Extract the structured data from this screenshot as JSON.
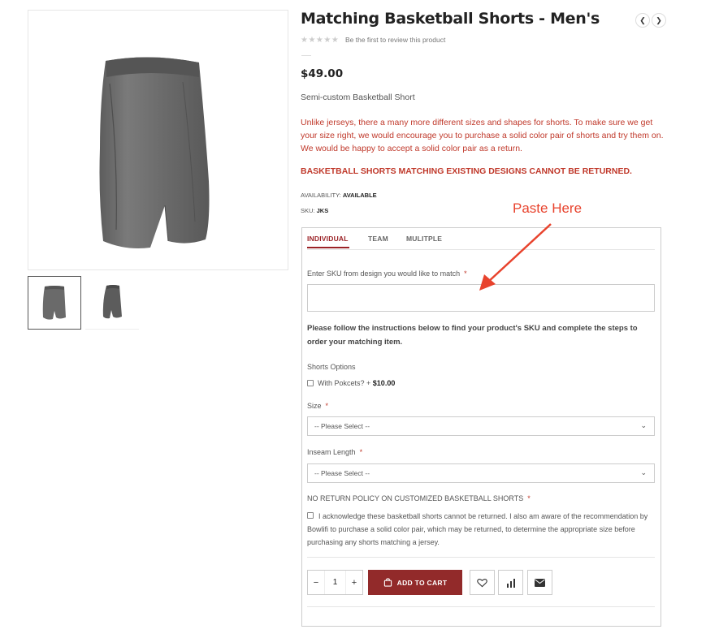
{
  "product": {
    "title": "Matching Basketball Shorts - Men's",
    "review_link": "Be the first to review this product",
    "price": "$49.00",
    "subtitle": "Semi-custom Basketball Short",
    "description": "Unlike jerseys, there a many more different sizes and shapes for shorts.  To make sure we get your size right, we would encourage you to purchase a solid color pair of shorts and try them on.  We would be happy to accept a solid color pair as a return.",
    "warning": "BASKETBALL SHORTS MATCHING EXISTING DESIGNS CANNOT BE RETURNED.",
    "availability_label": "AVAILABILITY:",
    "availability_value": "AVAILABLE",
    "sku_label": "SKU:",
    "sku_value": "JKS",
    "rating_stars": 0
  },
  "annotation": {
    "text": "Paste Here",
    "color": "#e8432d"
  },
  "tabs": [
    {
      "label": "INDIVIDUAL",
      "active": true
    },
    {
      "label": "TEAM",
      "active": false
    },
    {
      "label": "MULITPLE",
      "active": false
    }
  ],
  "form": {
    "sku_field_label": "Enter SKU from design you would like to match",
    "sku_field_value": "",
    "required_mark": "*",
    "instructions": "Please follow the instructions below to find your product's SKU and complete the steps to order your matching item.",
    "shorts_options_label": "Shorts Options",
    "pockets_option_label": "With Pokcets? +",
    "pockets_option_price": "$10.00",
    "size_label": "Size",
    "size_selected": "-- Please Select --",
    "inseam_label": "Inseam Length",
    "inseam_selected": "-- Please Select --",
    "policy_label": "NO RETURN POLICY ON CUSTOMIZED BASKETBALL SHORTS",
    "policy_text": "I acknowledge these basketball shorts cannot be returned. I also am aware of the recommendation by Bowlifi to purchase a solid color pair, which may be returned, to determine the appropriate size before purchasing any shorts matching a jersey."
  },
  "cart": {
    "qty_minus": "−",
    "qty_value": "1",
    "qty_plus": "+",
    "add_to_cart_label": "ADD TO CART"
  },
  "colors": {
    "accent": "#922a2a",
    "warning_text": "#c0392b",
    "shorts_gray": "#6e6e6e"
  }
}
